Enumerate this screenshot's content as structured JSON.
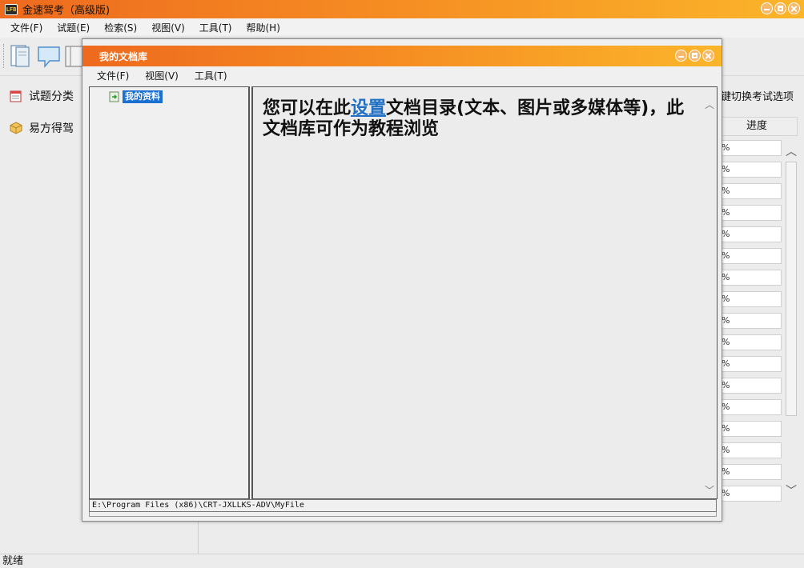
{
  "app": {
    "icon_text": "LFB",
    "title": "金速驾考（高级版)"
  },
  "menubar": [
    "文件(F)",
    "试题(E)",
    "检索(S)",
    "视图(V)",
    "工具(T)",
    "帮助(H)"
  ],
  "left_panel": {
    "items": [
      {
        "label": "试题分类",
        "icon": "calendar-icon"
      },
      {
        "label": "易方得驾",
        "icon": "package-icon"
      }
    ]
  },
  "right_panel": {
    "hint": "键切换考试选项",
    "progress_header": "进度",
    "progress_cells": [
      "%",
      "%",
      "%",
      "%",
      "%",
      "%",
      "%",
      "%",
      "%",
      "%",
      "%",
      "%",
      "%",
      "%",
      "%",
      "%",
      "%"
    ]
  },
  "status": {
    "text": "就绪"
  },
  "dialog": {
    "title": "我的文档库",
    "menubar": [
      "文件(F)",
      "视图(V)",
      "工具(T)"
    ],
    "tree": {
      "root_label": "我的资料"
    },
    "content": {
      "text_before": "您可以在此",
      "link": "设置",
      "text_after": "文档目录(文本、图片或多媒体等)，此文档库可作为教程浏览"
    },
    "path": "E:\\Program Files (x86)\\CRT-JXLLKS-ADV\\MyFile"
  },
  "colors": {
    "title_gradient_start": "#ee6a1e",
    "title_gradient_end": "#fbb52a",
    "selection": "#1a6fd0",
    "link": "#1f6fc5"
  }
}
